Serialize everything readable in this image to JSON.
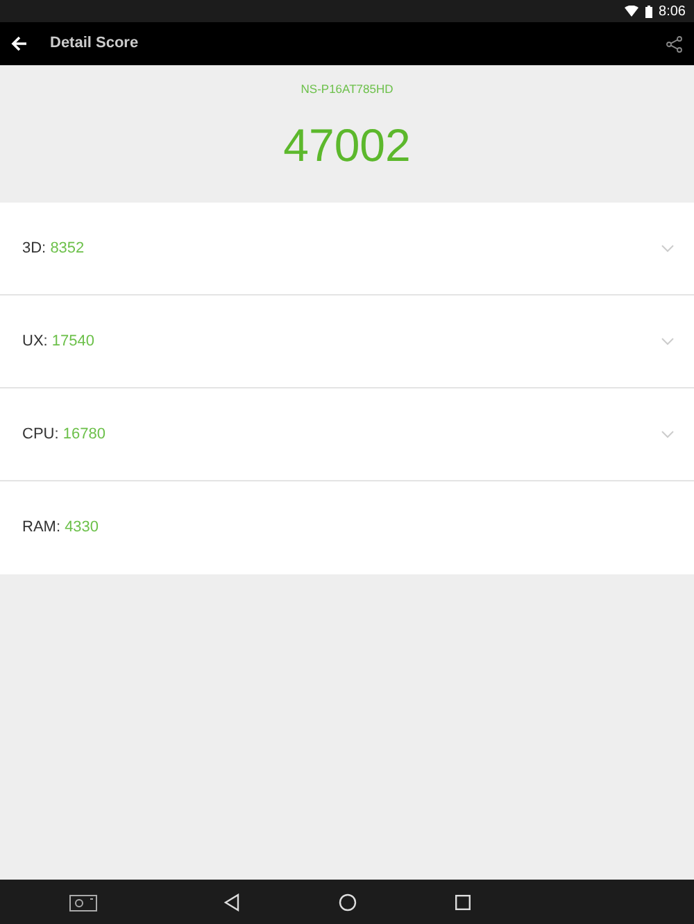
{
  "status_bar": {
    "time": "8:06"
  },
  "app_bar": {
    "title": "Detail Score"
  },
  "device": "NS-P16AT785HD",
  "total_score": "47002",
  "scores": [
    {
      "label": "3D:",
      "value": "8352",
      "kind": "expandable"
    },
    {
      "label": "UX:",
      "value": "17540",
      "kind": "expandable"
    },
    {
      "label": "CPU:",
      "value": "16780",
      "kind": "expandable"
    },
    {
      "label": "RAM:",
      "value": "4330",
      "kind": "plain"
    }
  ]
}
